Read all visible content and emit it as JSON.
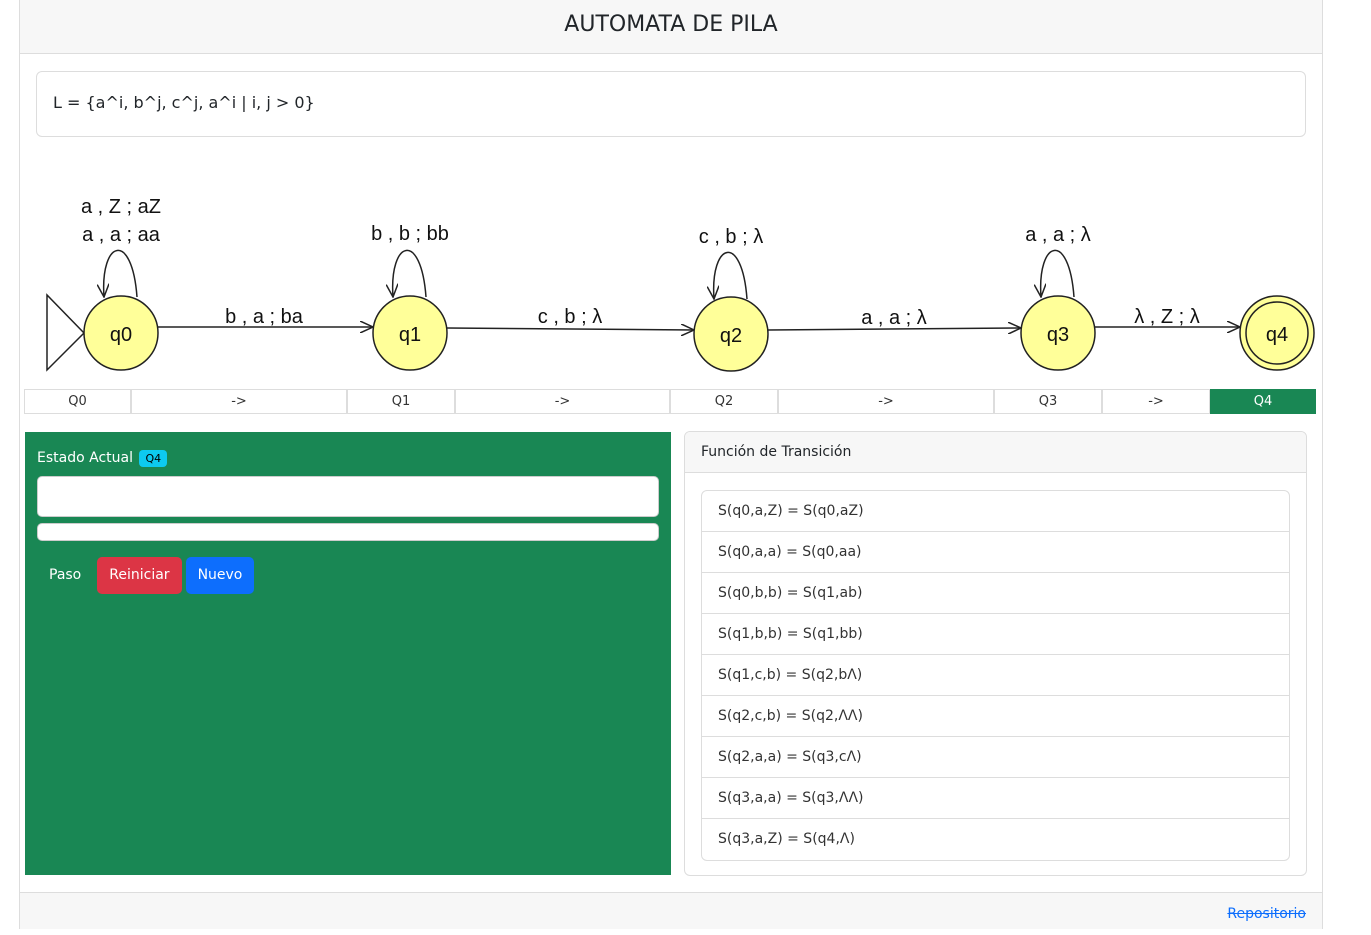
{
  "header": {
    "title": "AUTOMATA DE PILA"
  },
  "language": "L = {a^i, b^j, c^j, a^i | i, j > 0}",
  "diagram": {
    "states": [
      "q0",
      "q1",
      "q2",
      "q3",
      "q4"
    ],
    "initial_state": "q0",
    "final_state": "q4",
    "loops": {
      "q0": [
        "a , Z ; aZ",
        "a , a ; aa"
      ],
      "q1": [
        "b , b ; bb"
      ],
      "q2": [
        "c , b ; λ"
      ],
      "q3": [
        "a , a ; λ"
      ]
    },
    "edges": [
      {
        "from": "q0",
        "to": "q1",
        "label": "b , a ; ba"
      },
      {
        "from": "q1",
        "to": "q2",
        "label": "c , b ; λ"
      },
      {
        "from": "q2",
        "to": "q3",
        "label": "a , a ; λ"
      },
      {
        "from": "q3",
        "to": "q4",
        "label": "λ , Z ; λ"
      }
    ],
    "state_fill": "#ffff99"
  },
  "tape": [
    "Q0",
    "->",
    "Q1",
    "->",
    "Q2",
    "->",
    "Q3",
    "->",
    "Q4"
  ],
  "tape_active_index": 8,
  "panel": {
    "estado_label": "Estado Actual",
    "estado_badge": "Q4",
    "input_value": "",
    "paso": "Paso",
    "reiniciar": "Reiniciar",
    "nuevo": "Nuevo",
    "color": "#198754"
  },
  "transitions": {
    "title": "Función de Transición",
    "items": [
      "S(q0,a,Z) = S(q0,aZ)",
      "S(q0,a,a) = S(q0,aa)",
      "S(q0,b,b) = S(q1,ab)",
      "S(q1,b,b) = S(q1,bb)",
      "S(q1,c,b) = S(q2,bΛ)",
      "S(q2,c,b) = S(q2,ΛΛ)",
      "S(q2,a,a) = S(q3,cΛ)",
      "S(q3,a,a) = S(q3,ΛΛ)",
      "S(q3,a,Z) = S(q4,Λ)"
    ]
  },
  "footer": {
    "link": "Repositorio"
  }
}
